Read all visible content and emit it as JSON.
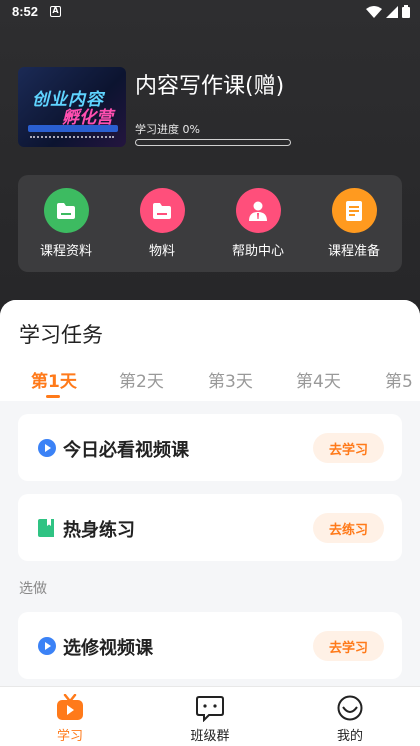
{
  "status_bar": {
    "time": "8:52",
    "notification_glyph": "A"
  },
  "course": {
    "thumb_line1": "创业内容",
    "thumb_line2": "孵化营",
    "title": "内容写作课(赠)",
    "progress_label": "学习进度 0%",
    "progress_value": 0
  },
  "quick_actions": [
    {
      "label": "课程资料",
      "icon": "folder-icon",
      "color": "#3dbb61"
    },
    {
      "label": "物料",
      "icon": "folder-icon",
      "color": "#ff4f7b"
    },
    {
      "label": "帮助中心",
      "icon": "person-icon",
      "color": "#ff4f7b"
    },
    {
      "label": "课程准备",
      "icon": "document-icon",
      "color": "#ff9a1f"
    }
  ],
  "tasks_section": {
    "title": "学习任务",
    "day_tabs": [
      "第1天",
      "第2天",
      "第3天",
      "第4天",
      "第5"
    ],
    "active_day": 0,
    "tasks": [
      {
        "label": "今日必看视频课",
        "button": "去学习",
        "icon": "play-icon"
      },
      {
        "label": "热身练习",
        "button": "去练习",
        "icon": "book-icon"
      }
    ],
    "optional_label": "选做",
    "optional_tasks": [
      {
        "label": "选修视频课",
        "button": "去学习",
        "icon": "play-icon"
      }
    ]
  },
  "bottom_nav": [
    {
      "label": "学习",
      "icon": "tv-icon",
      "active": true
    },
    {
      "label": "班级群",
      "icon": "chat-icon",
      "active": false
    },
    {
      "label": "我的",
      "icon": "profile-icon",
      "active": false
    }
  ],
  "colors": {
    "accent": "#ff7a1a",
    "hero_bg": "#2e2e30",
    "panel_bg": "#3c3c3e",
    "play_blue": "#3b82f6",
    "book_green": "#2fc383"
  }
}
